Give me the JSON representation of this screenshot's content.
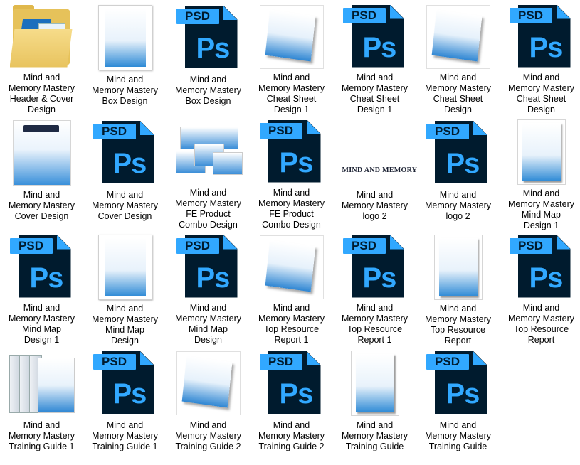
{
  "files": [
    {
      "icon": "folder-icon",
      "label": "Mind and\nMemory Mastery\nHeader & Cover\nDesign"
    },
    {
      "icon": "box-image-icon",
      "label": "Mind and\nMemory Mastery\nBox Design"
    },
    {
      "icon": "psd-file-icon",
      "label": "Mind and\nMemory Mastery\nBox Design",
      "psd_tag": "PSD",
      "psd_mark": "Ps"
    },
    {
      "icon": "book-image-icon",
      "label": "Mind and\nMemory Mastery\nCheat Sheet\nDesign 1"
    },
    {
      "icon": "psd-file-icon",
      "label": "Mind and\nMemory Mastery\nCheat Sheet\nDesign 1",
      "psd_tag": "PSD",
      "psd_mark": "Ps"
    },
    {
      "icon": "book-image-icon",
      "label": "Mind and\nMemory Mastery\nCheat Sheet\nDesign"
    },
    {
      "icon": "psd-file-icon",
      "label": "Mind and\nMemory Mastery\nCheat Sheet\nDesign",
      "psd_tag": "PSD",
      "psd_mark": "Ps"
    },
    {
      "icon": "cover-image-icon",
      "label": "Mind and\nMemory Mastery\nCover Design"
    },
    {
      "icon": "psd-file-icon",
      "label": "Mind and\nMemory Mastery\nCover Design",
      "psd_tag": "PSD",
      "psd_mark": "Ps"
    },
    {
      "icon": "combo-image-icon",
      "label": "Mind and\nMemory Mastery\nFE Product\nCombo Design"
    },
    {
      "icon": "psd-file-icon",
      "label": "Mind and\nMemory Mastery\nFE Product\nCombo Design",
      "psd_tag": "PSD",
      "psd_mark": "Ps"
    },
    {
      "icon": "logo-image-icon",
      "label": "Mind and\nMemory Mastery\nlogo 2",
      "logo_text": "MIND AND MEMORY"
    },
    {
      "icon": "psd-file-icon",
      "label": "Mind and\nMemory Mastery\nlogo 2",
      "psd_tag": "PSD",
      "psd_mark": "Ps"
    },
    {
      "icon": "tall-image-icon",
      "label": "Mind and\nMemory Mastery\nMind Map\nDesign 1"
    },
    {
      "icon": "psd-file-icon",
      "label": "Mind and\nMemory Mastery\nMind Map\nDesign 1",
      "psd_tag": "PSD",
      "psd_mark": "Ps"
    },
    {
      "icon": "box-image-icon",
      "label": "Mind and\nMemory Mastery\nMind Map\nDesign"
    },
    {
      "icon": "psd-file-icon",
      "label": "Mind and\nMemory Mastery\nMind Map\nDesign",
      "psd_tag": "PSD",
      "psd_mark": "Ps"
    },
    {
      "icon": "book-image-icon",
      "label": "Mind and\nMemory Mastery\nTop Resource\nReport 1"
    },
    {
      "icon": "psd-file-icon",
      "label": "Mind and\nMemory Mastery\nTop Resource\nReport 1",
      "psd_tag": "PSD",
      "psd_mark": "Ps"
    },
    {
      "icon": "tall-image-icon",
      "label": "Mind and\nMemory Mastery\nTop Resource\nReport"
    },
    {
      "icon": "psd-file-icon",
      "label": "Mind and\nMemory Mastery\nTop Resource\nReport",
      "psd_tag": "PSD",
      "psd_mark": "Ps"
    },
    {
      "icon": "binder-image-icon",
      "label": "Mind and\nMemory Mastery\nTraining Guide 1"
    },
    {
      "icon": "psd-file-icon",
      "label": "Mind and\nMemory Mastery\nTraining Guide 1",
      "psd_tag": "PSD",
      "psd_mark": "Ps"
    },
    {
      "icon": "book-image-icon",
      "label": "Mind and\nMemory Mastery\nTraining Guide 2"
    },
    {
      "icon": "psd-file-icon",
      "label": "Mind and\nMemory Mastery\nTraining Guide 2",
      "psd_tag": "PSD",
      "psd_mark": "Ps"
    },
    {
      "icon": "tall-image-icon",
      "label": "Mind and\nMemory Mastery\nTraining Guide"
    },
    {
      "icon": "psd-file-icon",
      "label": "Mind and\nMemory Mastery\nTraining Guide",
      "psd_tag": "PSD",
      "psd_mark": "Ps"
    }
  ],
  "colors": {
    "psd_dark": "#001b2e",
    "psd_blue": "#31a8ff",
    "folder": "#e6c25a"
  }
}
